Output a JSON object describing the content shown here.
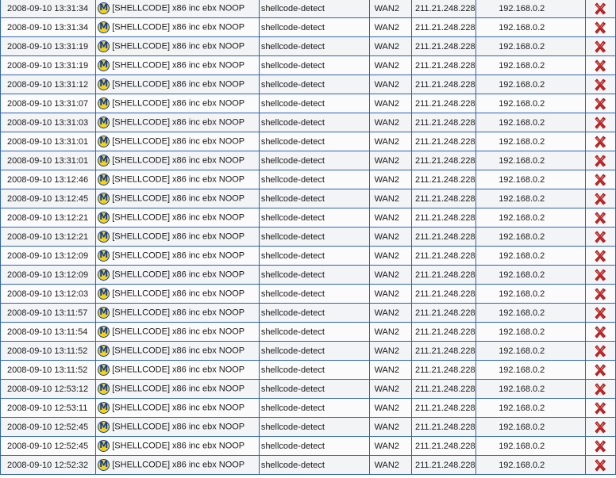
{
  "icons": {
    "severity": "m-badge-icon",
    "delete": "red-x-delete-icon"
  },
  "colors": {
    "border": "#2f63b3",
    "badge_fill": "#f5d312",
    "badge_ring": "#103b9e",
    "delete": "#d42626"
  },
  "rows": [
    {
      "time": "2008-09-10 13:31:34",
      "badge": "M",
      "message": "[SHELLCODE] x86 inc ebx NOOP",
      "classification": "shellcode-detect",
      "interface": "WAN2",
      "source": "211.21.248.228",
      "destination": "192.168.0.2"
    },
    {
      "time": "2008-09-10 13:31:34",
      "badge": "M",
      "message": "[SHELLCODE] x86 inc ebx NOOP",
      "classification": "shellcode-detect",
      "interface": "WAN2",
      "source": "211.21.248.228",
      "destination": "192.168.0.2"
    },
    {
      "time": "2008-09-10 13:31:19",
      "badge": "M",
      "message": "[SHELLCODE] x86 inc ebx NOOP",
      "classification": "shellcode-detect",
      "interface": "WAN2",
      "source": "211.21.248.228",
      "destination": "192.168.0.2"
    },
    {
      "time": "2008-09-10 13:31:19",
      "badge": "M",
      "message": "[SHELLCODE] x86 inc ebx NOOP",
      "classification": "shellcode-detect",
      "interface": "WAN2",
      "source": "211.21.248.228",
      "destination": "192.168.0.2"
    },
    {
      "time": "2008-09-10 13:31:12",
      "badge": "M",
      "message": "[SHELLCODE] x86 inc ebx NOOP",
      "classification": "shellcode-detect",
      "interface": "WAN2",
      "source": "211.21.248.228",
      "destination": "192.168.0.2"
    },
    {
      "time": "2008-09-10 13:31:07",
      "badge": "M",
      "message": "[SHELLCODE] x86 inc ebx NOOP",
      "classification": "shellcode-detect",
      "interface": "WAN2",
      "source": "211.21.248.228",
      "destination": "192.168.0.2"
    },
    {
      "time": "2008-09-10 13:31:03",
      "badge": "M",
      "message": "[SHELLCODE] x86 inc ebx NOOP",
      "classification": "shellcode-detect",
      "interface": "WAN2",
      "source": "211.21.248.228",
      "destination": "192.168.0.2"
    },
    {
      "time": "2008-09-10 13:31:01",
      "badge": "M",
      "message": "[SHELLCODE] x86 inc ebx NOOP",
      "classification": "shellcode-detect",
      "interface": "WAN2",
      "source": "211.21.248.228",
      "destination": "192.168.0.2"
    },
    {
      "time": "2008-09-10 13:31:01",
      "badge": "M",
      "message": "[SHELLCODE] x86 inc ebx NOOP",
      "classification": "shellcode-detect",
      "interface": "WAN2",
      "source": "211.21.248.228",
      "destination": "192.168.0.2"
    },
    {
      "time": "2008-09-10 13:12:46",
      "badge": "M",
      "message": "[SHELLCODE] x86 inc ebx NOOP",
      "classification": "shellcode-detect",
      "interface": "WAN2",
      "source": "211.21.248.228",
      "destination": "192.168.0.2"
    },
    {
      "time": "2008-09-10 13:12:45",
      "badge": "M",
      "message": "[SHELLCODE] x86 inc ebx NOOP",
      "classification": "shellcode-detect",
      "interface": "WAN2",
      "source": "211.21.248.228",
      "destination": "192.168.0.2"
    },
    {
      "time": "2008-09-10 13:12:21",
      "badge": "M",
      "message": "[SHELLCODE] x86 inc ebx NOOP",
      "classification": "shellcode-detect",
      "interface": "WAN2",
      "source": "211.21.248.228",
      "destination": "192.168.0.2"
    },
    {
      "time": "2008-09-10 13:12:21",
      "badge": "M",
      "message": "[SHELLCODE] x86 inc ebx NOOP",
      "classification": "shellcode-detect",
      "interface": "WAN2",
      "source": "211.21.248.228",
      "destination": "192.168.0.2"
    },
    {
      "time": "2008-09-10 13:12:09",
      "badge": "M",
      "message": "[SHELLCODE] x86 inc ebx NOOP",
      "classification": "shellcode-detect",
      "interface": "WAN2",
      "source": "211.21.248.228",
      "destination": "192.168.0.2"
    },
    {
      "time": "2008-09-10 13:12:09",
      "badge": "M",
      "message": "[SHELLCODE] x86 inc ebx NOOP",
      "classification": "shellcode-detect",
      "interface": "WAN2",
      "source": "211.21.248.228",
      "destination": "192.168.0.2"
    },
    {
      "time": "2008-09-10 13:12:03",
      "badge": "M",
      "message": "[SHELLCODE] x86 inc ebx NOOP",
      "classification": "shellcode-detect",
      "interface": "WAN2",
      "source": "211.21.248.228",
      "destination": "192.168.0.2"
    },
    {
      "time": "2008-09-10 13:11:57",
      "badge": "M",
      "message": "[SHELLCODE] x86 inc ebx NOOP",
      "classification": "shellcode-detect",
      "interface": "WAN2",
      "source": "211.21.248.228",
      "destination": "192.168.0.2"
    },
    {
      "time": "2008-09-10 13:11:54",
      "badge": "M",
      "message": "[SHELLCODE] x86 inc ebx NOOP",
      "classification": "shellcode-detect",
      "interface": "WAN2",
      "source": "211.21.248.228",
      "destination": "192.168.0.2"
    },
    {
      "time": "2008-09-10 13:11:52",
      "badge": "M",
      "message": "[SHELLCODE] x86 inc ebx NOOP",
      "classification": "shellcode-detect",
      "interface": "WAN2",
      "source": "211.21.248.228",
      "destination": "192.168.0.2"
    },
    {
      "time": "2008-09-10 13:11:52",
      "badge": "M",
      "message": "[SHELLCODE] x86 inc ebx NOOP",
      "classification": "shellcode-detect",
      "interface": "WAN2",
      "source": "211.21.248.228",
      "destination": "192.168.0.2"
    },
    {
      "time": "2008-09-10 12:53:12",
      "badge": "M",
      "message": "[SHELLCODE] x86 inc ebx NOOP",
      "classification": "shellcode-detect",
      "interface": "WAN2",
      "source": "211.21.248.228",
      "destination": "192.168.0.2"
    },
    {
      "time": "2008-09-10 12:53:11",
      "badge": "M",
      "message": "[SHELLCODE] x86 inc ebx NOOP",
      "classification": "shellcode-detect",
      "interface": "WAN2",
      "source": "211.21.248.228",
      "destination": "192.168.0.2"
    },
    {
      "time": "2008-09-10 12:52:45",
      "badge": "M",
      "message": "[SHELLCODE] x86 inc ebx NOOP",
      "classification": "shellcode-detect",
      "interface": "WAN2",
      "source": "211.21.248.228",
      "destination": "192.168.0.2"
    },
    {
      "time": "2008-09-10 12:52:45",
      "badge": "M",
      "message": "[SHELLCODE] x86 inc ebx NOOP",
      "classification": "shellcode-detect",
      "interface": "WAN2",
      "source": "211.21.248.228",
      "destination": "192.168.0.2"
    },
    {
      "time": "2008-09-10 12:52:32",
      "badge": "M",
      "message": "[SHELLCODE] x86 inc ebx NOOP",
      "classification": "shellcode-detect",
      "interface": "WAN2",
      "source": "211.21.248.228",
      "destination": "192.168.0.2"
    }
  ]
}
